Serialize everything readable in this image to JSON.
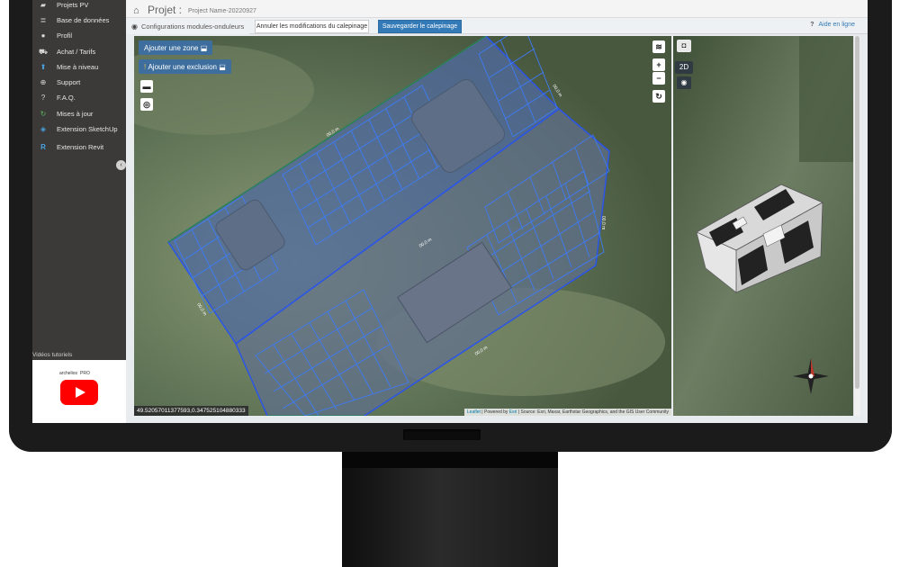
{
  "sidebar": {
    "items": [
      {
        "label": "Projets PV",
        "icon": "folder-open-icon"
      },
      {
        "label": "Base de données",
        "icon": "database-icon"
      },
      {
        "label": "Profil",
        "icon": "user-icon"
      },
      {
        "label": "Achat / Tarifs",
        "icon": "cart-icon"
      },
      {
        "label": "Mise à niveau",
        "icon": "arrow-up-icon"
      },
      {
        "label": "Support",
        "icon": "lifebuoy-icon"
      },
      {
        "label": "F.A.Q.",
        "icon": "question-icon"
      },
      {
        "label": "Mises à jour",
        "icon": "refresh-icon"
      },
      {
        "label": "Extension SketchUp",
        "icon": "sketchup-icon"
      },
      {
        "label": "Extension Revit",
        "icon": "revit-icon"
      }
    ],
    "videos_label": "Vidéos tutoriels",
    "video_brand": "archelios",
    "video_brand_suffix": "PRO"
  },
  "header": {
    "title": "Projet :",
    "project_name": "Project Name-20220927"
  },
  "toolbar": {
    "config_tab": "Configurations modules-onduleurs",
    "cancel_label": "Annuler les modifications du calepinage",
    "save_label": "Sauvegarder le calepinage",
    "help_label": "Aide en ligne"
  },
  "map": {
    "add_zone": "Ajouter une zone",
    "add_exclusion": "Ajouter une exclusion",
    "zoom_in": "+",
    "zoom_out": "−",
    "coords": "49.52057011377593,0.3475251048803​33",
    "attribution_leaflet": "Leaflet",
    "attribution_powered": "| Powered by",
    "attribution_esri": "Esri",
    "attribution_source": "| Source: Esri, Maxar, Earthstar Geographics, and the GIS User Community"
  },
  "view3d": {
    "mode_label": "2D"
  },
  "colors": {
    "accent": "#337ab7",
    "sidebar_bg": "#3b3a39",
    "panel_blue": "#2f6ef0"
  }
}
